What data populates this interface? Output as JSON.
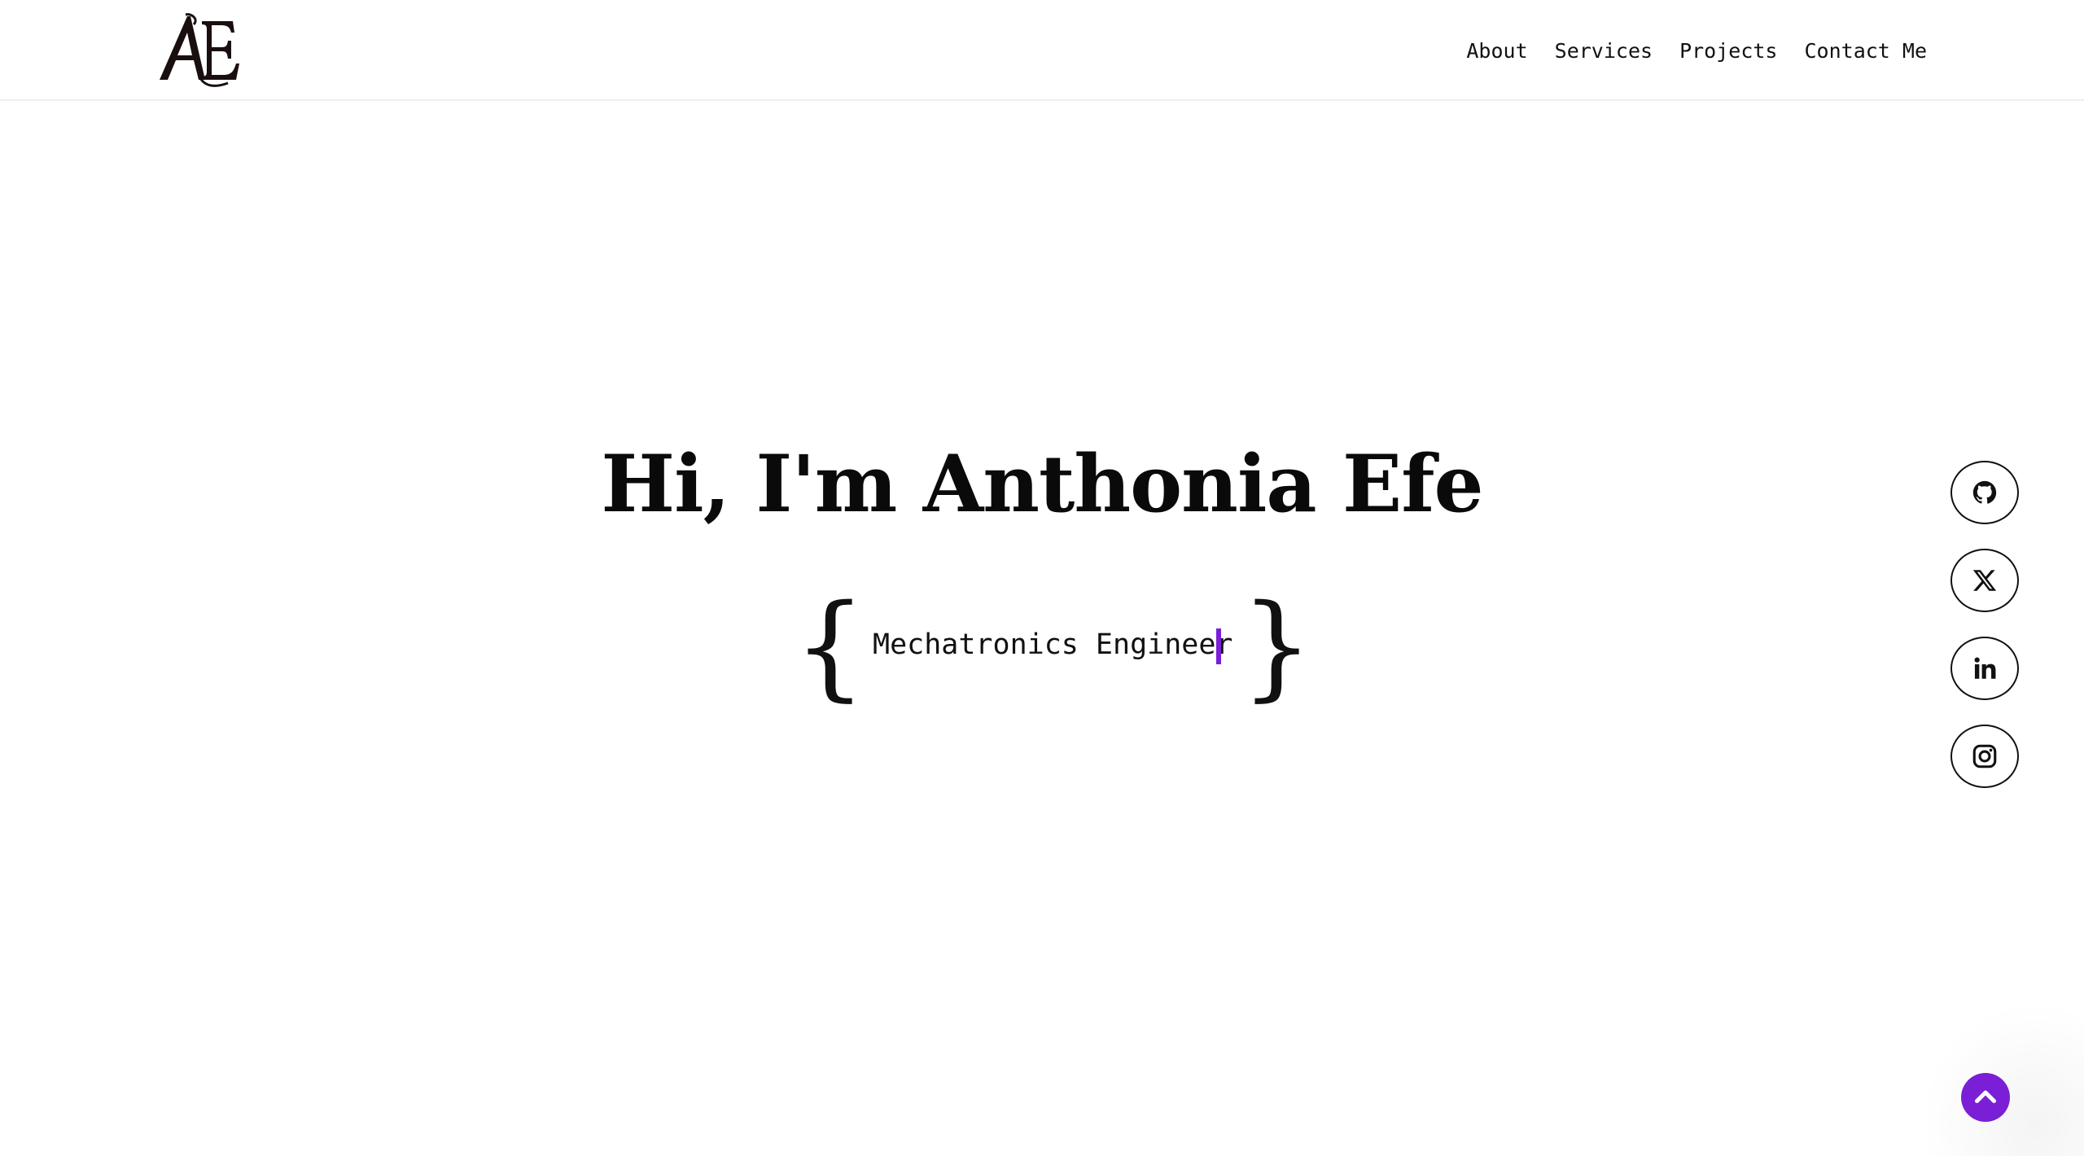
{
  "header": {
    "logo_text": "AE",
    "nav": [
      {
        "label": "About"
      },
      {
        "label": "Services"
      },
      {
        "label": "Projects"
      },
      {
        "label": "Contact Me"
      }
    ]
  },
  "hero": {
    "title": "Hi, I'm Anthonia Efe",
    "brace_open": "{",
    "brace_close": "}",
    "role": "Mechatronics Engineer",
    "cursor_color": "#7a1fd6"
  },
  "social": [
    {
      "icon": "github-icon"
    },
    {
      "icon": "x-twitter-icon"
    },
    {
      "icon": "linkedin-icon"
    },
    {
      "icon": "instagram-icon"
    }
  ],
  "scroll_top": {
    "icon": "chevron-up-icon",
    "color": "#7a1fd6"
  }
}
